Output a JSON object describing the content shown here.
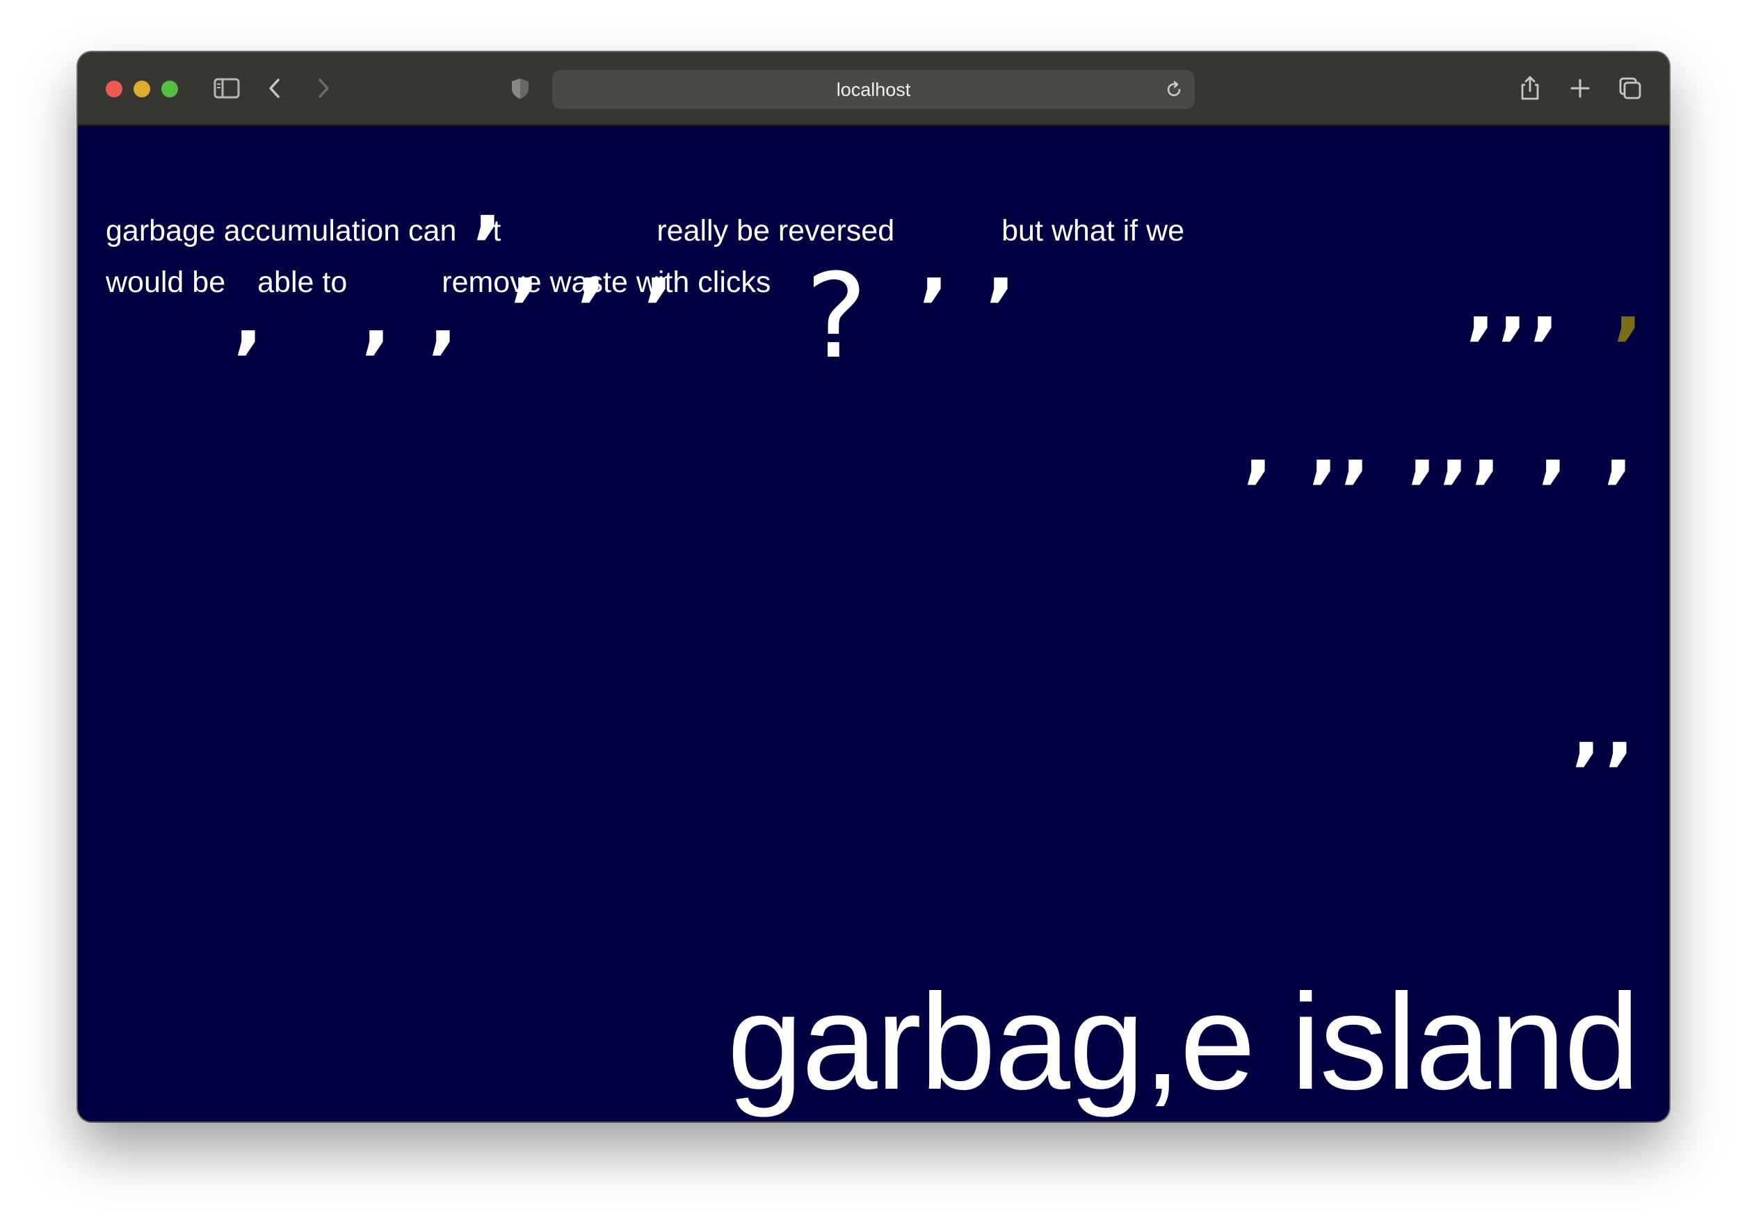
{
  "browser": {
    "url": "localhost",
    "icons": {
      "sidebar": "sidebar-icon",
      "back": "chevron-left-icon",
      "forward": "chevron-right-icon",
      "privacy": "shield-icon",
      "reload": "reload-icon",
      "share": "share-icon",
      "new_tab": "plus-icon",
      "tabs": "tabs-overview-icon"
    }
  },
  "page": {
    "background_color": "#000042",
    "text_color": "#ffffff",
    "accent_comma_color": "#7a6e14",
    "paragraph": {
      "line1_part1": "garbage accumulation can",
      "line1_part2": "t",
      "line1_part3": "really be reversed",
      "line1_part4": "but what if we",
      "line2_part1": "would be",
      "line2_part2": "able to",
      "line2_part3": "remove waste with clicks"
    },
    "comma_glyph": ",",
    "question_glyph": "?",
    "title": "garbag,e island"
  }
}
